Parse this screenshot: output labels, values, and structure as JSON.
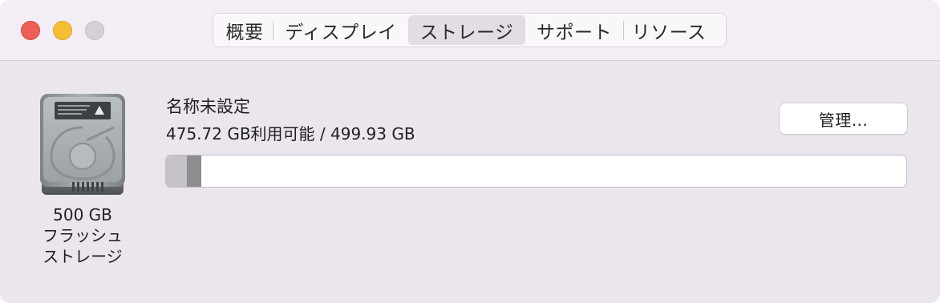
{
  "window": {
    "traffic_lights": [
      "close",
      "minimize",
      "maximize"
    ]
  },
  "tabs": [
    {
      "label": "概要",
      "active": false
    },
    {
      "label": "ディスプレイ",
      "active": false
    },
    {
      "label": "ストレージ",
      "active": true
    },
    {
      "label": "サポート",
      "active": false
    },
    {
      "label": "リソース",
      "active": false
    }
  ],
  "drive": {
    "icon": "hard-drive-icon",
    "caption_line1": "500 GB",
    "caption_line2": "フラッシュ",
    "caption_line3": "ストレージ"
  },
  "disk": {
    "name": "名称未設定",
    "capacity": "475.72 GB利用可能 / 499.93 GB",
    "manage_label": "管理..."
  },
  "storage_bar": {
    "segments": [
      {
        "fraction": 0.028,
        "color": "#c4c2c6"
      },
      {
        "fraction": 0.02,
        "color": "#8e8c91"
      }
    ],
    "free_color": "#ffffff"
  },
  "colors": {
    "close": "#ee5f58",
    "minimize": "#f6be35",
    "maximize": "#d5d0d8"
  }
}
